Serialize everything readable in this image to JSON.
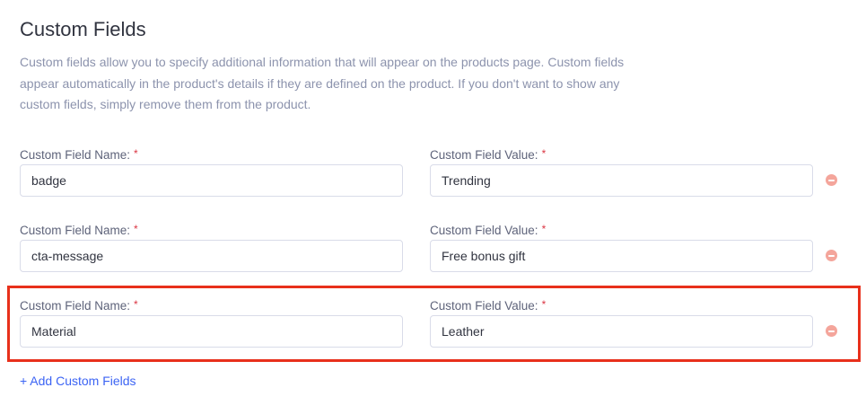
{
  "section": {
    "title": "Custom Fields",
    "description_lines": [
      "Custom fields allow you to specify additional information that will appear on the products page. Custom fields",
      "appear automatically in the product's details if they are defined on the product. If you don't want to show any",
      "custom fields, simply remove them from the product."
    ]
  },
  "labels": {
    "name": "Custom Field Name:",
    "value": "Custom Field Value:",
    "required_marker": "*"
  },
  "fields": [
    {
      "name": "badge",
      "value": "Trending"
    },
    {
      "name": "cta-message",
      "value": "Free bonus gift"
    },
    {
      "name": "Material",
      "value": "Leather"
    }
  ],
  "add_link": "+ Add Custom Fields",
  "colors": {
    "highlight": "#e8301b",
    "remove_icon": "#f4a59b",
    "link": "#3c64f4",
    "required": "#db3643"
  }
}
